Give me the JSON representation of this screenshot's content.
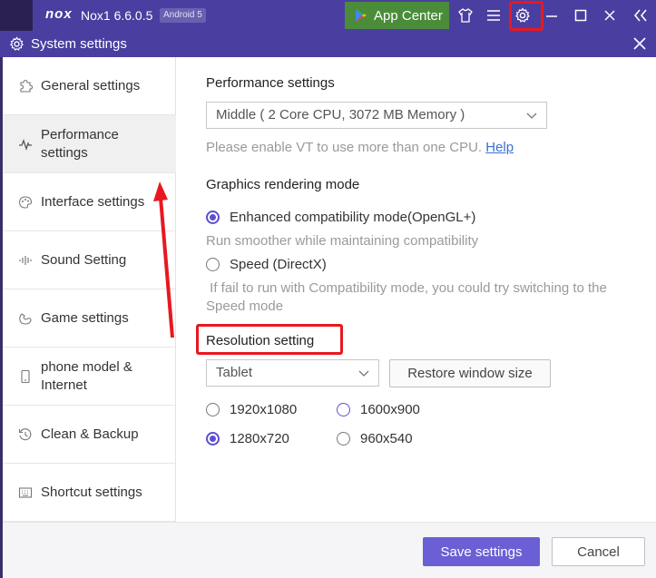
{
  "titlebar": {
    "logo": "nox",
    "title": "Nox1 6.6.0.5",
    "android_badge": "Android 5",
    "app_center": "App Center"
  },
  "window": {
    "title": "System settings"
  },
  "sidebar": {
    "items": [
      {
        "label": "General settings",
        "icon": "puzzle-icon"
      },
      {
        "label": "Performance settings",
        "icon": "pulse-icon"
      },
      {
        "label": "Interface settings",
        "icon": "palette-icon"
      },
      {
        "label": "Sound Setting",
        "icon": "sound-icon"
      },
      {
        "label": "Game settings",
        "icon": "game-icon"
      },
      {
        "label": "phone model & Internet",
        "icon": "phone-icon"
      },
      {
        "label": "Clean & Backup",
        "icon": "history-icon"
      },
      {
        "label": "Shortcut settings",
        "icon": "keyboard-icon"
      }
    ],
    "active_index": 1
  },
  "performance": {
    "title": "Performance settings",
    "selected": "Middle ( 2 Core CPU, 3072 MB Memory )",
    "hint": "Please enable VT to use more than one CPU.",
    "help_link": "Help"
  },
  "graphics": {
    "title": "Graphics rendering mode",
    "option1": "Enhanced compatibility mode(OpenGL+)",
    "option1_hint": "Run smoother while maintaining compatibility",
    "option2": "Speed (DirectX)",
    "option2_hint": " If fail to run with Compatibility mode, you could try switching to the Speed mode"
  },
  "resolution": {
    "title": "Resolution setting",
    "selected": "Tablet",
    "restore_button": "Restore window size",
    "options": [
      "1920x1080",
      "1600x900",
      "1280x720",
      "960x540"
    ],
    "checked": "1280x720"
  },
  "footer": {
    "save": "Save settings",
    "cancel": "Cancel"
  },
  "colors": {
    "accent": "#5b4fd0",
    "titlebar": "#4a3fa0",
    "highlight": "#e8181f"
  }
}
